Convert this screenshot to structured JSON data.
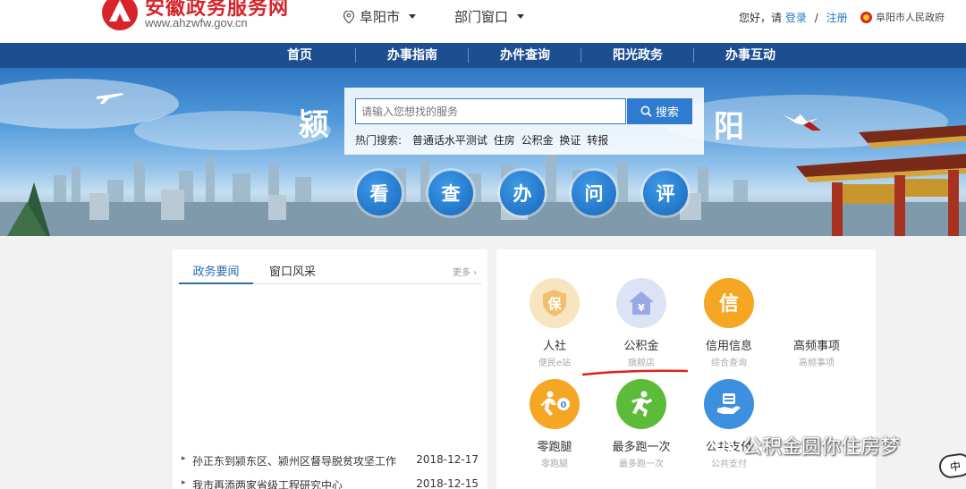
{
  "header": {
    "site_title": "安徽政务服务网",
    "site_url": "www.ahzwfw.gov.cn",
    "location": "阜阳市",
    "dept_window": "部门窗口",
    "greeting": "您好，请",
    "login": "登录",
    "separator": "/",
    "register": "注册",
    "gov_name": "阜阳市人民政府"
  },
  "nav": {
    "items": [
      "首页",
      "办事指南",
      "办件查询",
      "阳光政务",
      "办事互动"
    ]
  },
  "banner": {
    "calligraphy_left": "颍",
    "calligraphy_right": "阳",
    "search": {
      "placeholder": "请输入您想找的服务",
      "button": "搜索",
      "hot_label": "热门搜索:",
      "hot_items": [
        "普通话水平测试",
        "住房",
        "公积金",
        "换证",
        "转报"
      ]
    },
    "quick_buttons": [
      "看",
      "查",
      "办",
      "问",
      "评"
    ]
  },
  "news": {
    "tabs": [
      "政务要闻",
      "窗口风采"
    ],
    "more": "更多",
    "items": [
      {
        "title": "孙正东到颍东区、颍州区督导脱贫攻坚工作",
        "date": "2018-12-17"
      },
      {
        "title": "我市再添两家省级工程研究中心",
        "date": "2018-12-15"
      }
    ]
  },
  "services": [
    {
      "icon": "shield-icon",
      "icon_char": "保",
      "title": "人社",
      "subtitle": "便民e站",
      "color": "#f5d9a8"
    },
    {
      "icon": "house-icon",
      "icon_char": "¥",
      "title": "公积金",
      "subtitle": "旗舰店",
      "color": "#d4dcf5"
    },
    {
      "icon": "credit-icon",
      "icon_char": "信",
      "title": "信用信息",
      "subtitle": "综合查询",
      "color": "#f5a623"
    },
    {
      "icon": "",
      "icon_char": "",
      "title": "高频事项",
      "subtitle": "高频事项",
      "color": ""
    },
    {
      "icon": "runner-icon",
      "icon_char": "0",
      "title": "零跑腿",
      "subtitle": "零跑腿",
      "color": "#f5a623"
    },
    {
      "icon": "running-man-icon",
      "icon_char": "",
      "title": "最多跑一次",
      "subtitle": "最多跑一次",
      "color": "#5dbb3a"
    },
    {
      "icon": "payment-icon",
      "icon_char": "",
      "title": "公共支付",
      "subtitle": "公共支付",
      "color": "#3d8fe0"
    }
  ],
  "watermark": {
    "text": "公积金圆你住房梦",
    "ime": "中"
  }
}
